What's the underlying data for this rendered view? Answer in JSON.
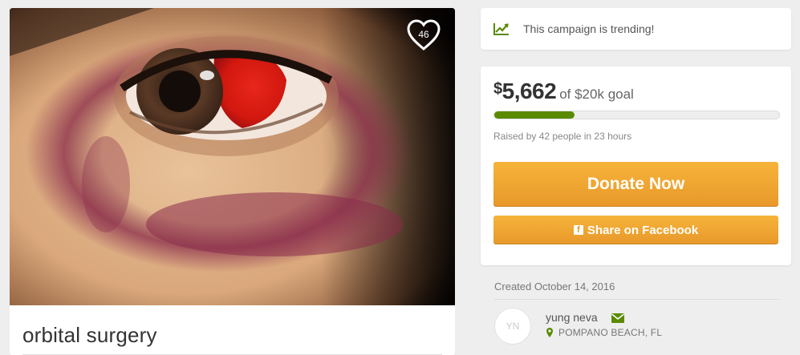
{
  "campaign": {
    "title": "orbital surgery",
    "heart_count": "46"
  },
  "trending": {
    "text": "This campaign is trending!",
    "icon": "trend-chart-icon"
  },
  "funding": {
    "currency_symbol": "$",
    "amount": "5,662",
    "goal_text": "of $20k goal",
    "progress_fraction": 0.283,
    "raised_by_text": "Raised by 42 people in 23 hours"
  },
  "actions": {
    "donate_label": "Donate Now",
    "share_label": "Share on Facebook",
    "share_icon": "facebook-icon"
  },
  "organizer": {
    "created_text": "Created October 14, 2016",
    "initials": "YN",
    "name": "yung neva",
    "location": "POMPANO BEACH, FL"
  },
  "colors": {
    "accent_orange": "#f0a733",
    "progress_green": "#5a8a00",
    "background": "#eeeeee"
  }
}
